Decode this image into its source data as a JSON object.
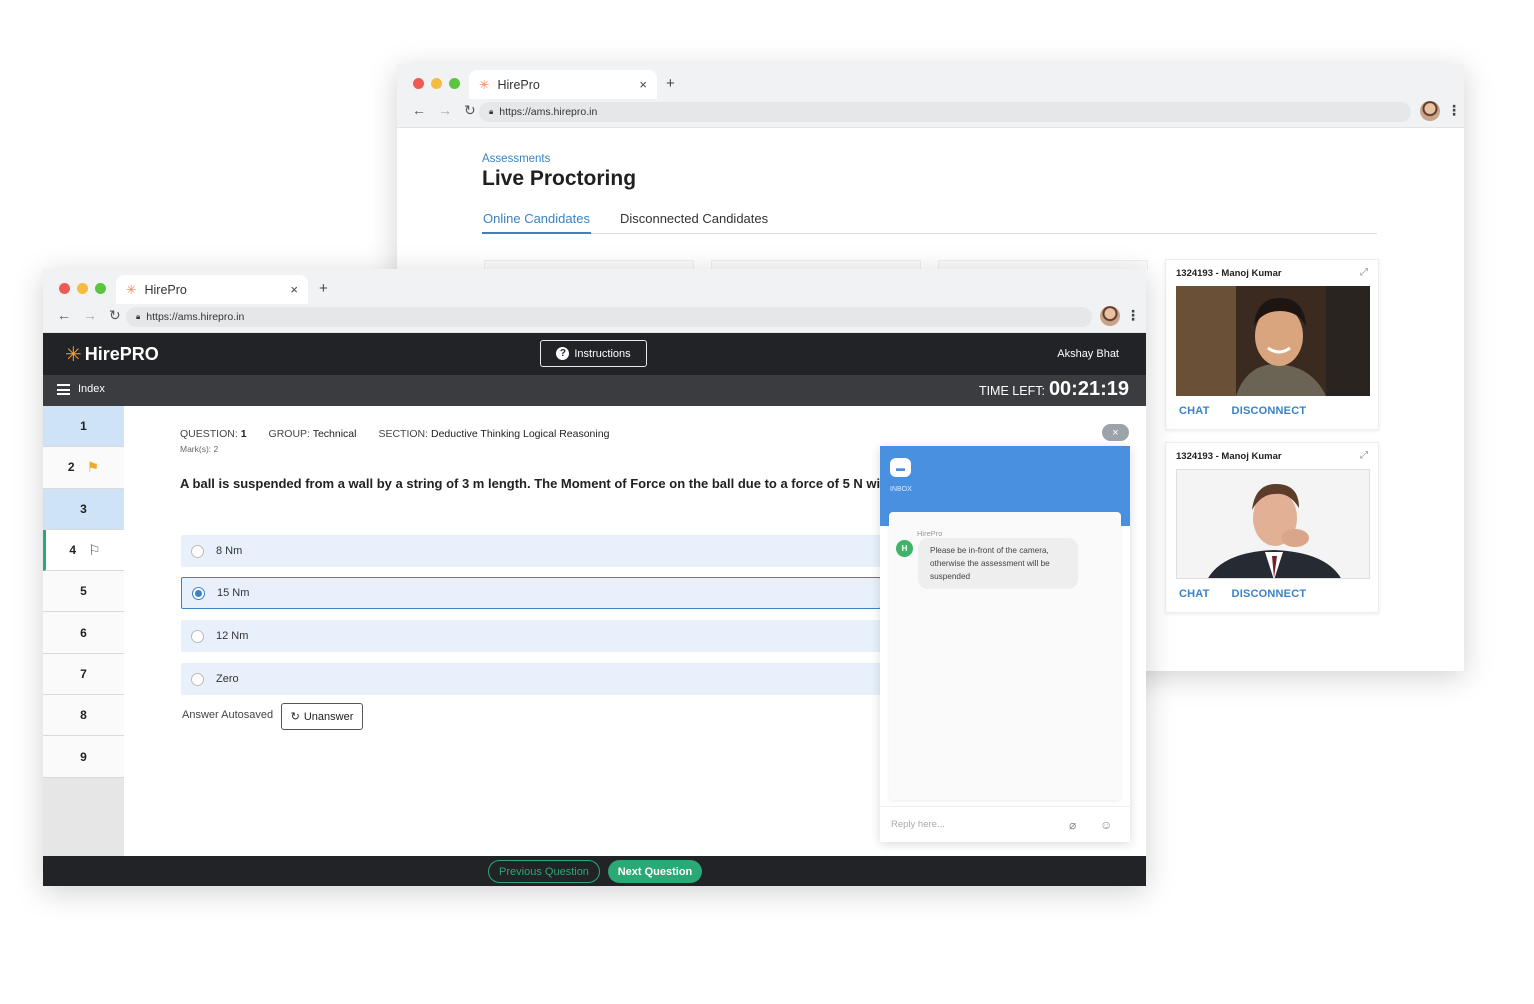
{
  "back_window": {
    "tab_title": "HirePro",
    "url": "https://ams.hirepro.in",
    "breadcrumb": "Assessments",
    "page_title": "Live Proctoring",
    "tabs": [
      {
        "label": "Online Candidates"
      },
      {
        "label": "Disconnected Candidates"
      }
    ],
    "candidates": [
      {
        "name": "1324193 - Manoj Kumar",
        "chat": "CHAT",
        "disconnect": "DISCONNECT"
      },
      {
        "name": "1324193 - Manoj Kumar",
        "chat": "CHAT",
        "disconnect": "DISCONNECT"
      }
    ]
  },
  "front_window": {
    "tab_title": "HirePro",
    "url": "https://ams.hirepro.in",
    "logo_text": "HirePRO",
    "instructions_label": "Instructions",
    "user_name": "Akshay Bhat",
    "index_label": "Index",
    "time_left_label": "TIME LEFT:",
    "time_left_value": "00:21:19",
    "questions": [
      {
        "num": "1",
        "state": "answered"
      },
      {
        "num": "2",
        "state": "flagged"
      },
      {
        "num": "3",
        "state": "answered"
      },
      {
        "num": "4",
        "state": "current"
      },
      {
        "num": "5",
        "state": "unvisited"
      },
      {
        "num": "6",
        "state": "unvisited"
      },
      {
        "num": "7",
        "state": "unvisited"
      },
      {
        "num": "8",
        "state": "unvisited"
      },
      {
        "num": "9",
        "state": "unvisited"
      }
    ],
    "meta": {
      "question_label": "QUESTION:",
      "question_value": "1",
      "group_label": "GROUP:",
      "group_value": "Technical",
      "section_label": "SECTION:",
      "section_value": "Deductive Thinking Logical Reasoning",
      "marks": "Mark(s): 2"
    },
    "question_text": "A ball is suspended from a wall by a string of 3 m length. The Moment of Force on the ball due to a force of 5 N will",
    "options": [
      {
        "label": "8 Nm",
        "selected": false
      },
      {
        "label": "15 Nm",
        "selected": true
      },
      {
        "label": "12 Nm",
        "selected": false
      },
      {
        "label": "Zero",
        "selected": false
      }
    ],
    "autosaved": "Answer Autosaved",
    "unanswer": "Unanswer",
    "prev": "Previous Question",
    "next": "Next Question"
  },
  "chat": {
    "close": "×",
    "inbox_label": "INBOX",
    "sender": "HirePro",
    "avatar_letter": "H",
    "message": "Please be in-front of the camera, otherwise the assessment will be suspended",
    "reply_placeholder": "Reply here..."
  },
  "colors": {
    "accent": "#3b82c4",
    "green": "#2aa876",
    "dark": "#222326",
    "chat_header": "#4a90e0"
  },
  "icons": [
    "back-arrow-icon",
    "forward-arrow-icon",
    "reload-icon",
    "lock-icon",
    "expand-icon",
    "question-icon",
    "hamburger-icon",
    "flag-icon",
    "undo-icon",
    "attach-icon",
    "emoji-icon",
    "close-icon",
    "inbox-icon"
  ]
}
